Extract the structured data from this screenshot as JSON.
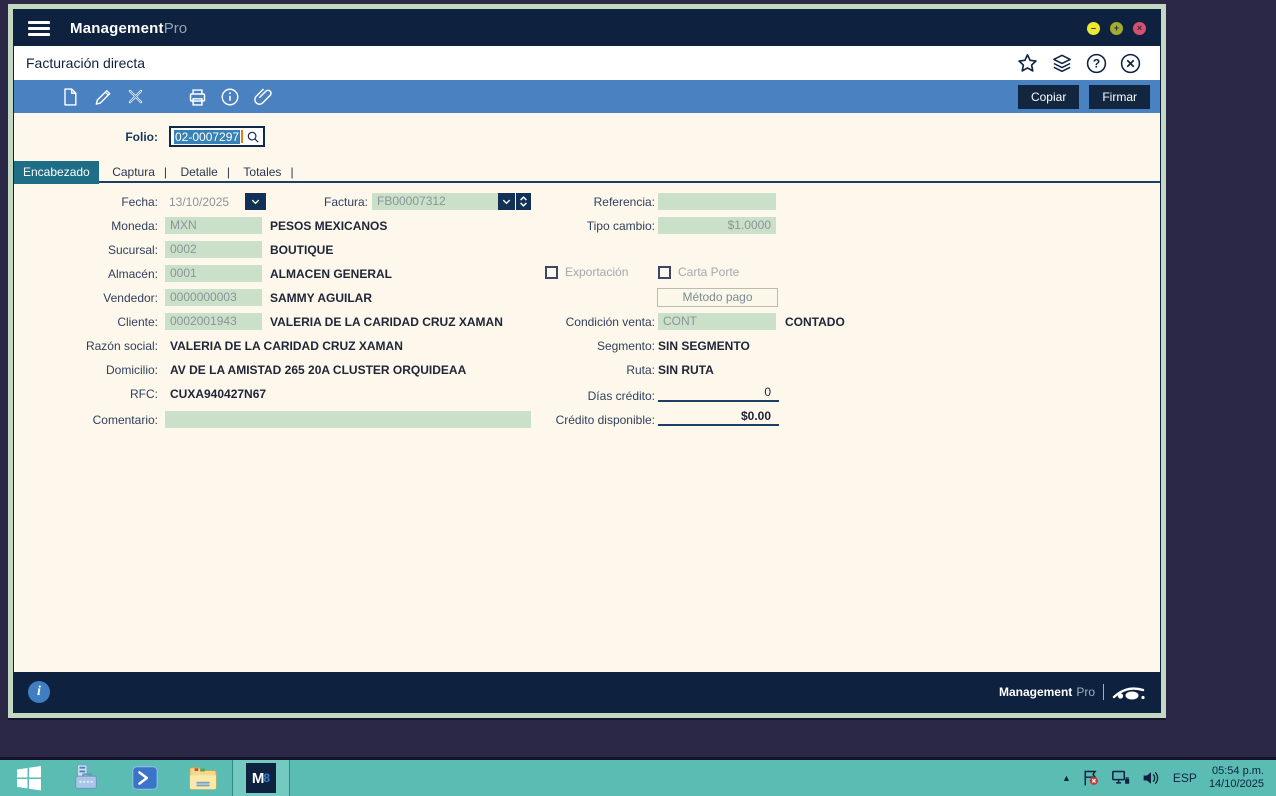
{
  "colors": {
    "navy": "#0e2240",
    "toolbar_blue": "#4a81c1",
    "field_green": "#cbe0c8",
    "tab_teal": "#1d6e86",
    "cream": "#fdf8eb",
    "window_border": "#c3d8c2",
    "desktop": "#2b2847",
    "taskbar_teal": "#5abcb3",
    "selection_blue": "#3782b4",
    "caret_orange": "#e87d1e"
  },
  "icons": {
    "menu": "hamburger",
    "favorite": "star",
    "views": "layers",
    "help": "question-circle",
    "close": "x-circle",
    "new": "document",
    "edit": "pencil",
    "delete": "x",
    "print": "printer",
    "info": "info-circle",
    "attach": "paperclip",
    "search": "magnifier",
    "tray": [
      "hidden-icons-arrow",
      "action-flag",
      "network",
      "volume"
    ]
  },
  "titlebar": {
    "brand_bold": "Management",
    "brand_light": "Pro"
  },
  "window_controls": {
    "minimize": "–",
    "maximize": "+",
    "close": "×"
  },
  "pagebar": {
    "title": "Facturación directa"
  },
  "toolbar": {
    "copiar": "Copiar",
    "firmar": "Firmar"
  },
  "folio": {
    "label": "Folio:",
    "value": "02-0007297"
  },
  "tabs": [
    {
      "label": "Encabezado",
      "active": true
    },
    {
      "label": "Captura",
      "active": false
    },
    {
      "label": "Detalle",
      "active": false
    },
    {
      "label": "Totales",
      "active": false
    }
  ],
  "form": {
    "fecha": {
      "label": "Fecha:",
      "value": "13/10/2025"
    },
    "factura": {
      "label": "Factura:",
      "value": "FB00007312"
    },
    "referencia": {
      "label": "Referencia:",
      "value": ""
    },
    "moneda": {
      "label": "Moneda:",
      "value": "MXN",
      "desc": "PESOS MEXICANOS"
    },
    "tipo_cambio": {
      "label": "Tipo cambio:",
      "value": "$1.0000"
    },
    "sucursal": {
      "label": "Sucursal:",
      "value": "0002",
      "desc": "BOUTIQUE"
    },
    "almacen": {
      "label": "Almacén:",
      "value": "0001",
      "desc": "ALMACEN GENERAL"
    },
    "vendedor": {
      "label": "Vendedor:",
      "value": "0000000003",
      "desc": "SAMMY AGUILAR"
    },
    "cliente": {
      "label": "Cliente:",
      "value": "0002001943",
      "desc": "VALERIA DE LA CARIDAD CRUZ XAMAN"
    },
    "razon_social": {
      "label": "Razón social:",
      "value": "VALERIA DE LA CARIDAD CRUZ XAMAN"
    },
    "domicilio": {
      "label": "Domicilio:",
      "value": "AV DE LA AMISTAD 265 20A CLUSTER ORQUIDEAA"
    },
    "rfc": {
      "label": "RFC:",
      "value": "CUXA940427N67"
    },
    "comentario": {
      "label": "Comentario:",
      "value": ""
    },
    "exportacion": {
      "label": "Exportación",
      "checked": false
    },
    "carta_porte": {
      "label": "Carta Porte",
      "checked": false
    },
    "metodo_pago": {
      "label": "Método pago"
    },
    "condicion_venta": {
      "label": "Condición venta:",
      "value": "CONT",
      "desc": "CONTADO"
    },
    "segmento": {
      "label": "Segmento:",
      "value": "SIN SEGMENTO"
    },
    "ruta": {
      "label": "Ruta:",
      "value": "SIN RUTA"
    },
    "dias_credito": {
      "label": "Días crédito:",
      "value": "0"
    },
    "credito_disponible": {
      "label": "Crédito disponible:",
      "value": "$0.00"
    }
  },
  "footer": {
    "brand_bold": "Management",
    "brand_light": "Pro"
  },
  "taskbar": {
    "language": "ESP",
    "time": "05:54 p.m.",
    "date": "14/10/2025"
  }
}
